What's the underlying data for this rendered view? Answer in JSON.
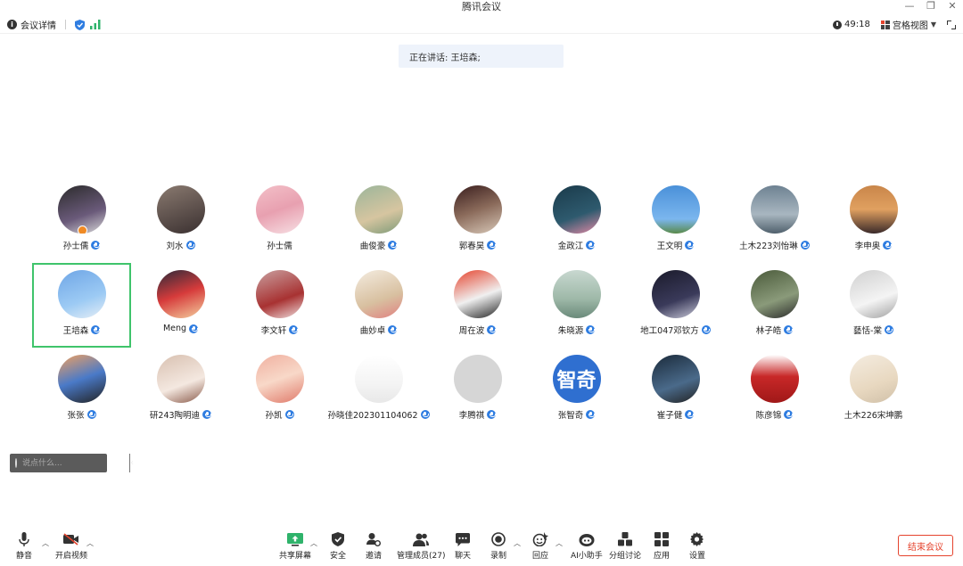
{
  "window": {
    "title": "腾讯会议"
  },
  "infobar": {
    "meeting_details": "会议详情",
    "timer": "49:18",
    "view_mode": "宫格视图"
  },
  "speaking": {
    "text": "正在讲话: 王培森;"
  },
  "participants": [
    {
      "name": "孙士儒",
      "mic": true,
      "host": true,
      "bg": "linear-gradient(160deg,#2b2b2b,#6a5a7a 60%,#d9d9d9)"
    },
    {
      "name": "刘水",
      "mic": true,
      "bg": "linear-gradient(160deg,#8a7a70,#3a3030)"
    },
    {
      "name": "孙士儒",
      "mic": false,
      "bg": "linear-gradient(160deg,#f3c0c8,#e8a0b0 50%,#f7e0e4)"
    },
    {
      "name": "曲俊豪",
      "mic": true,
      "bg": "linear-gradient(160deg,#9bb59a,#d6c5a0 60%,#7d9a78)"
    },
    {
      "name": "郭春昊",
      "mic": true,
      "bg": "linear-gradient(160deg,#3a1e1e,#8a6a5a 50%,#d8c8b8)"
    },
    {
      "name": "金政江",
      "mic": true,
      "bg": "linear-gradient(160deg,#1a3a4a,#2e5a6e 60%,#e48aa6)"
    },
    {
      "name": "王文明",
      "mic": true,
      "bg": "linear-gradient(180deg,#4a90d9,#7bb6ee 70%,#5a8a4a)"
    },
    {
      "name": "土木223刘怡琳",
      "mic": true,
      "bg": "linear-gradient(180deg,#6e8292,#a8b6c0 60%,#50606c)"
    },
    {
      "name": "李申奥",
      "mic": true,
      "bg": "linear-gradient(180deg,#c9864a,#e0a060 50%,#3a2a2a)"
    },
    {
      "name": "王培森",
      "mic": true,
      "active": true,
      "bg": "linear-gradient(160deg,#6fa6e6,#9ccaf4 60%,#e6eef6)"
    },
    {
      "name": "Meng",
      "mic": true,
      "bg": "linear-gradient(160deg,#2a2a3a,#d63b3b 50%,#f4d0a0)"
    },
    {
      "name": "李文轩",
      "mic": true,
      "bg": "linear-gradient(160deg,#c9a0a0,#a83232 60%,#f0e0e0)"
    },
    {
      "name": "曲妙卓",
      "mic": true,
      "bg": "linear-gradient(160deg,#f4ece0,#d8c0a0 60%,#e08080)"
    },
    {
      "name": "周在波",
      "mic": true,
      "bg": "linear-gradient(160deg,#e5432d,#f0f0f0 55%,#222)"
    },
    {
      "name": "朱晓源",
      "mic": true,
      "bg": "linear-gradient(180deg,#c8d8d0,#9eb8a8 60%,#6a8a7a)"
    },
    {
      "name": "地工047邓钦方",
      "mic": true,
      "bg": "linear-gradient(160deg,#1a1a2a,#3a3a5a 60%,#c8c8d8)"
    },
    {
      "name": "林子皓",
      "mic": true,
      "bg": "linear-gradient(160deg,#4a5a3a,#8a9a7a 60%,#2a2a2a)"
    },
    {
      "name": "藝恬-棠",
      "mic": true,
      "bg": "linear-gradient(160deg,#d0d0d0,#f4f4f4 60%,#a0a0a0)"
    },
    {
      "name": "张张",
      "mic": true,
      "bg": "linear-gradient(160deg,#f0a060,#4a7ac8 50%,#222)"
    },
    {
      "name": "研243陶明迪",
      "mic": true,
      "bg": "linear-gradient(160deg,#d8c0b0,#f4e8e0 60%,#8a5a4a)"
    },
    {
      "name": "孙凯",
      "mic": true,
      "bg": "linear-gradient(160deg,#f0b0a0,#f8d8c8 50%,#e07a6a)"
    },
    {
      "name": "孙晓佳202301104062",
      "mic": true,
      "bg": "linear-gradient(180deg,#ffffff,#f4f4f4 60%,#e8e8e8)"
    },
    {
      "name": "李腾祺",
      "mic": true,
      "bg": "#d6d6d6"
    },
    {
      "name": "张智奇",
      "mic": true,
      "text": "智奇",
      "bg": "#2f6fd0"
    },
    {
      "name": "崔子健",
      "mic": true,
      "bg": "linear-gradient(160deg,#1a2a3a,#4a6a8a 60%,#222)"
    },
    {
      "name": "陈彦锦",
      "mic": true,
      "bg": "linear-gradient(180deg,#ffffff,#c82828 45%,#a01818)"
    },
    {
      "name": "土木226宋坤鹏",
      "mic": false,
      "bg": "linear-gradient(160deg,#f4ece0,#e8d8c0 60%,#d0c0a8)"
    }
  ],
  "chat": {
    "placeholder": "说点什么..."
  },
  "toolbar": {
    "mute": "静音",
    "video": "开启视频",
    "share": "共享屏幕",
    "security": "安全",
    "invite": "邀请",
    "members": "管理成员(27)",
    "chat": "聊天",
    "record": "录制",
    "react": "回应",
    "ai": "AI小助手",
    "breakout": "分组讨论",
    "apps": "应用",
    "settings": "设置",
    "end": "结束会议"
  },
  "colors": {
    "accent": "#2f7de1",
    "active_border": "#3fc46b",
    "danger": "#e5432d",
    "share_green": "#2fb36b"
  }
}
